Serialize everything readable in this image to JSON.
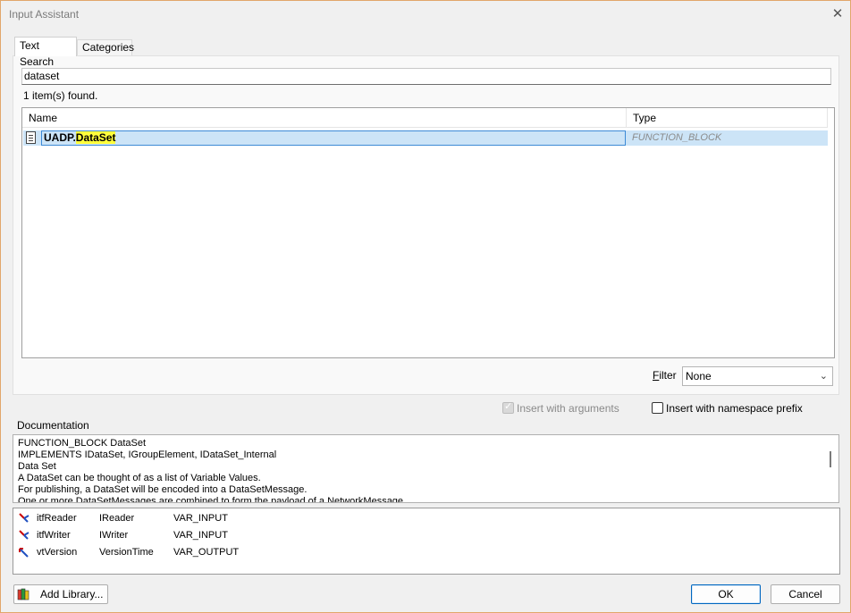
{
  "window": {
    "title": "Input Assistant",
    "close_glyph": "✕"
  },
  "tabs": [
    {
      "label": "Text Search"
    },
    {
      "label": "Categories"
    }
  ],
  "search": {
    "value": "dataset",
    "result_count": "1 item(s) found."
  },
  "list": {
    "columns": [
      "Name",
      "Type"
    ],
    "rows": [
      {
        "name_prefix": "UADP.",
        "name_match": "DataSet",
        "type": "FUNCTION_BLOCK",
        "icon": "document-icon",
        "selected": true
      }
    ]
  },
  "filter": {
    "label": "Filter",
    "value": "None"
  },
  "options": {
    "insert_with_arguments": {
      "label": "Insert with arguments",
      "checked": true,
      "disabled": true
    },
    "insert_with_namespace": {
      "label": "Insert with namespace prefix",
      "checked": false,
      "disabled": false
    }
  },
  "documentation": {
    "label": "Documentation",
    "lines": [
      "FUNCTION_BLOCK DataSet",
      "IMPLEMENTS IDataSet, IGroupElement, IDataSet_Internal",
      "Data Set",
      "A DataSet can be thought of as a list of Variable Values.",
      "For publishing, a DataSet will be encoded into  a DataSetMessage.",
      "One or more DataSetMessages are combined to form the payload of a NetworkMessage."
    ]
  },
  "variables": [
    {
      "name": "itfReader",
      "type": "IReader",
      "kind": "VAR_INPUT",
      "icon": "input-var-icon"
    },
    {
      "name": "itfWriter",
      "type": "IWriter",
      "kind": "VAR_INPUT",
      "icon": "input-var-icon"
    },
    {
      "name": "vtVersion",
      "type": "VersionTime",
      "kind": "VAR_OUTPUT",
      "icon": "output-var-icon"
    }
  ],
  "buttons": {
    "add_library": "Add Library...",
    "ok": "OK",
    "cancel": "Cancel"
  },
  "colors": {
    "selection": "#cce4f7",
    "highlight": "#ffff3c",
    "accent": "#0067c0",
    "window_border": "#e2a66b"
  }
}
